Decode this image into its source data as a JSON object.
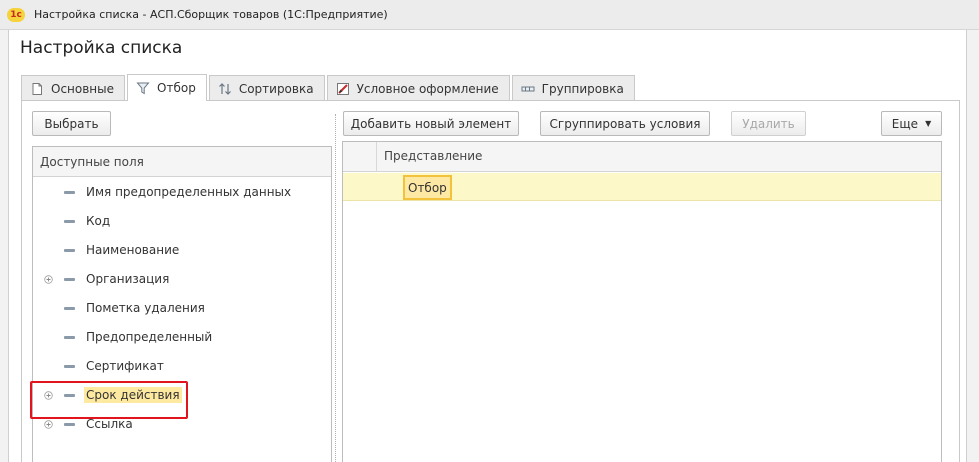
{
  "window": {
    "title": "Настройка списка - АСП.Сборщик товаров  (1С:Предприятие)",
    "logo_text": "1с"
  },
  "form": {
    "title": "Настройка списка"
  },
  "tabs": [
    {
      "label": "Основные",
      "icon": "page-icon",
      "active": false
    },
    {
      "label": "Отбор",
      "icon": "filter-icon",
      "active": true
    },
    {
      "label": "Сортировка",
      "icon": "sort-icon",
      "active": false
    },
    {
      "label": "Условное оформление",
      "icon": "conditional-format-icon",
      "active": false
    },
    {
      "label": "Группировка",
      "icon": "grouping-icon",
      "active": false
    }
  ],
  "toolbar": {
    "select": "Выбрать",
    "add_new_element": "Добавить новый элемент",
    "group_conditions": "Сгруппировать условия",
    "delete": "Удалить",
    "more": "Еще"
  },
  "fields_panel": {
    "header": "Доступные поля",
    "items": [
      {
        "label": "Имя предопределенных данных",
        "expandable": false,
        "highlighted": false
      },
      {
        "label": "Код",
        "expandable": false,
        "highlighted": false
      },
      {
        "label": "Наименование",
        "expandable": false,
        "highlighted": false
      },
      {
        "label": "Организация",
        "expandable": true,
        "highlighted": false
      },
      {
        "label": "Пометка удаления",
        "expandable": false,
        "highlighted": false
      },
      {
        "label": "Предопределенный",
        "expandable": false,
        "highlighted": false
      },
      {
        "label": "Сертификат",
        "expandable": false,
        "highlighted": false
      },
      {
        "label": "Срок действия",
        "expandable": true,
        "highlighted": true
      },
      {
        "label": "Ссылка",
        "expandable": true,
        "highlighted": false
      }
    ]
  },
  "filter_grid": {
    "column_header": "Представление",
    "rows": [
      {
        "label": "Отбор"
      }
    ]
  },
  "colors": {
    "highlight": "#fdeaa0",
    "selection_row": "#fdf8c8",
    "selection_cell_border": "#f2c23c",
    "annotation_frame": "#e3141b"
  }
}
